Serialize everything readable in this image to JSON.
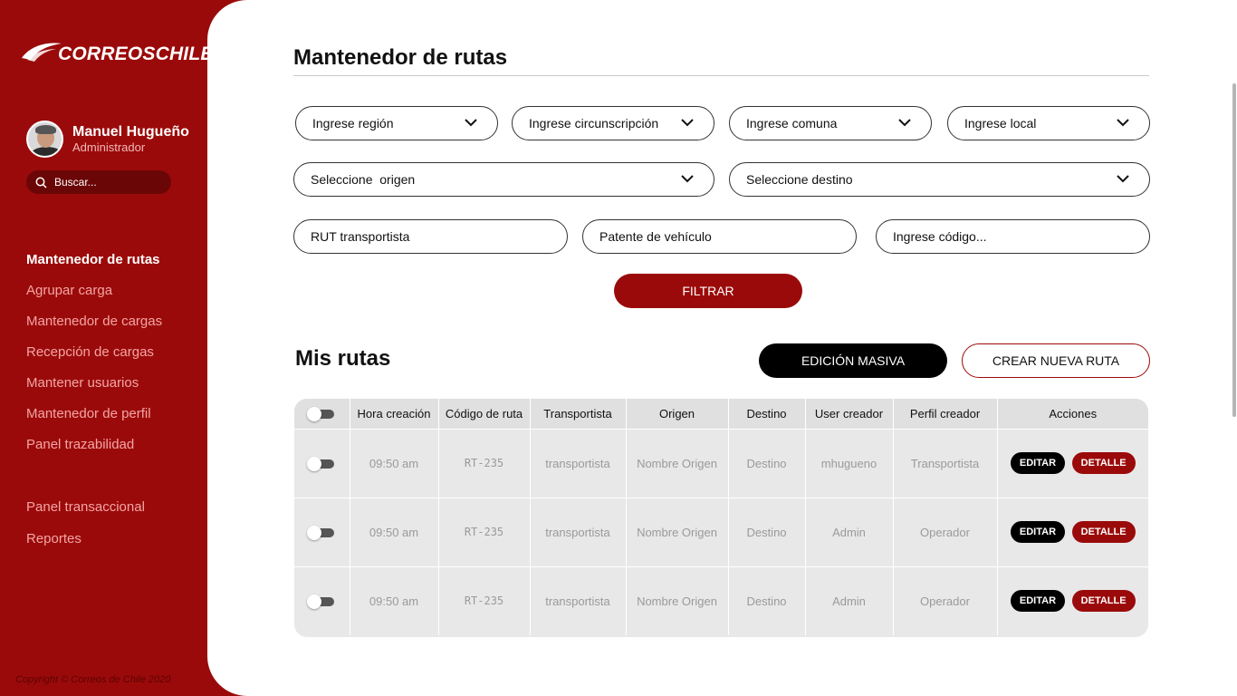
{
  "brand": {
    "logo_text": "CORREOSCHILE",
    "primary_color": "#9b0a0a"
  },
  "profile": {
    "name": "Manuel Hugueño",
    "role": "Administrador"
  },
  "search": {
    "placeholder": "Buscar..."
  },
  "nav": {
    "group1": [
      {
        "label": "Mantenedor de rutas",
        "active": true
      },
      {
        "label": "Agrupar carga"
      },
      {
        "label": "Mantenedor de cargas"
      },
      {
        "label": "Recepción de cargas"
      },
      {
        "label": "Mantener usuarios"
      },
      {
        "label": "Mantenedor de perfil"
      },
      {
        "label": "Panel trazabilidad"
      }
    ],
    "group2": [
      {
        "label": "Panel transaccional"
      },
      {
        "label": "Reportes"
      }
    ]
  },
  "copyright": "Copyright © Correos de Chile 2020",
  "page": {
    "title": "Mantenedor de rutas"
  },
  "filters": {
    "region": "Ingrese región",
    "circunscripcion": "Ingrese circunscripción",
    "comuna": "Ingrese comuna",
    "local": "Ingrese local",
    "origen": "Seleccione  origen",
    "destino": "Seleccione destino",
    "rut_placeholder": "RUT transportista",
    "patente_placeholder": "Patente de vehículo",
    "codigo_placeholder": "Ingrese código...",
    "filter_button": "FILTRAR"
  },
  "routes": {
    "title": "Mis rutas",
    "mass_edit_button": "EDICIÓN MASIVA",
    "new_route_button": "CREAR NUEVA RUTA",
    "columns": [
      "Hora creación",
      "Código de ruta",
      "Transportista",
      "Origen",
      "Destino",
      "User creador",
      "Perfil creador",
      "Acciones"
    ],
    "rows": [
      {
        "hora": "09:50 am",
        "codigo": "RT-235",
        "transportista": "transportista",
        "origen": "Nombre Origen",
        "destino": "Destino",
        "user": "mhugueno",
        "perfil": "Transportista",
        "edit": "EDITAR",
        "detail": "DETALLE"
      },
      {
        "hora": "09:50 am",
        "codigo": "RT-235",
        "transportista": "transportista",
        "origen": "Nombre Origen",
        "destino": "Destino",
        "user": "Admin",
        "perfil": "Operador",
        "edit": "EDITAR",
        "detail": "DETALLE"
      },
      {
        "hora": "09:50 am",
        "codigo": "RT-235",
        "transportista": "transportista",
        "origen": "Nombre Origen",
        "destino": "Destino",
        "user": "Admin",
        "perfil": "Operador",
        "edit": "EDITAR",
        "detail": "DETALLE"
      }
    ]
  }
}
